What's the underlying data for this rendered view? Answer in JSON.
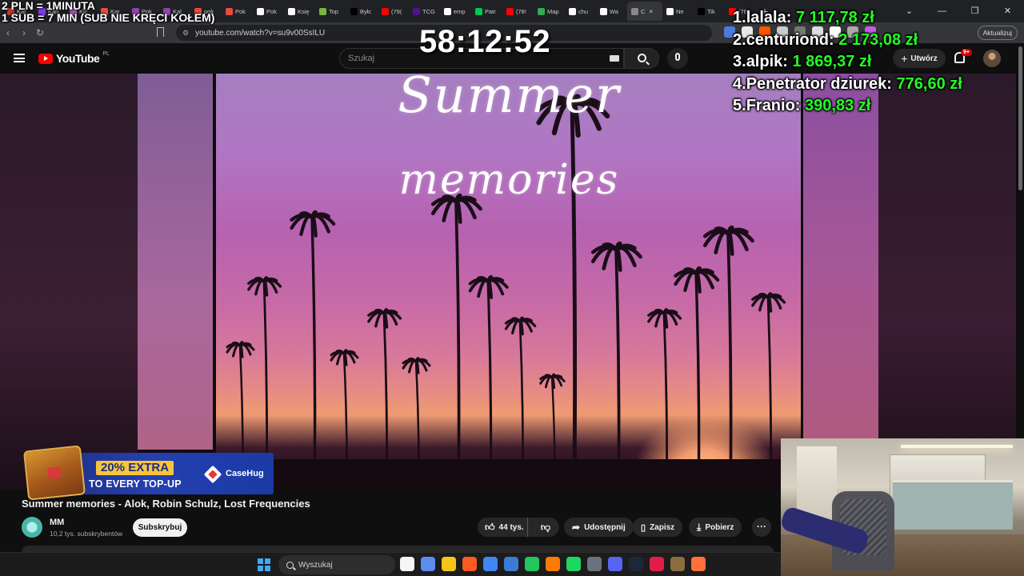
{
  "browser": {
    "tabs": [
      {
        "label": "Kar",
        "color": "#c0392b"
      },
      {
        "label": "Kan",
        "color": "#7c3aed"
      },
      {
        "label": "Kic",
        "color": "#9b59b6"
      },
      {
        "label": "Kar",
        "color": "#e74c3c"
      },
      {
        "label": "Pok",
        "color": "#8e44ad"
      },
      {
        "label": "Kal",
        "color": "#8e44ad"
      },
      {
        "label": "pok",
        "color": "#e74c3c"
      },
      {
        "label": "Pok",
        "color": "#e74c3c"
      },
      {
        "label": "Pok",
        "color": "#ffffff"
      },
      {
        "label": "Księ",
        "color": "#ffffff"
      },
      {
        "label": "Top",
        "color": "#7cb342"
      },
      {
        "label": "Byłc",
        "color": "#000000"
      },
      {
        "label": "(79(",
        "color": "#ff0000"
      },
      {
        "label": "TCG",
        "color": "#4a148c"
      },
      {
        "label": "emp",
        "color": "#ffffff"
      },
      {
        "label": "Patr",
        "color": "#00c853"
      },
      {
        "label": "(78!",
        "color": "#ff0000"
      },
      {
        "label": "Map",
        "color": "#34a853"
      },
      {
        "label": "chu",
        "color": "#ffffff"
      },
      {
        "label": "Wa",
        "color": "#ffffff"
      }
    ],
    "active_tab": {
      "label": "C",
      "close": "×"
    },
    "tabs_after": [
      {
        "label": "Ne",
        "color": "#ffffff"
      },
      {
        "label": "Tik",
        "color": "#000000"
      },
      {
        "label": "(78!",
        "color": "#ff0000"
      }
    ],
    "new_tab": "+",
    "window_controls": [
      "⌄",
      "—",
      "❐",
      "✕"
    ],
    "nav": {
      "back": "‹",
      "forward": "›",
      "reload": "↻"
    },
    "url": "youtube.com/watch?v=su9v00SsILU",
    "update_label": "Aktualizuj",
    "ext_colors": [
      "#4b7bd6",
      "#e8e8e8",
      "#ff5500",
      "#cccccc",
      "#777777",
      "#dddddd",
      "#ffffff",
      "#aaaaaa",
      "#c35de0"
    ]
  },
  "youtube": {
    "logo_text": "YouTube",
    "region": "PL",
    "search_placeholder": "Szukaj",
    "create_label": "Utwórz",
    "notif_count": "9+"
  },
  "video": {
    "overlay_title_1": "Summer",
    "overlay_title_2": "memories",
    "title": "Summer memories - Alok, Robin Schulz, Lost Frequencies",
    "channel": "MM",
    "subscribers": "10,2 tys. subskrybentów",
    "subscribe_label": "Subskrybuj",
    "likes": "44 tys.",
    "share_label": "Udostępnij",
    "save_label": "Zapisz",
    "download_label": "Pobierz",
    "more": "···"
  },
  "ad": {
    "extra": "20% EXTRA",
    "topup": "TO EVERY TOP-UP",
    "brand": "CaseHug"
  },
  "overlay": {
    "rate_line_1": "2 PLN = 1MINUTA",
    "rate_line_2": "1 SUB = 7 MIN (SUB NIE KRĘCI KOŁEM)",
    "timer": "58:12:52",
    "leaderboard": [
      {
        "rank": "1.",
        "name": "lalala:",
        "amount": "7 117,78 zł"
      },
      {
        "rank": "2.",
        "name": "centuriond:",
        "amount": "2 173,08 zł"
      },
      {
        "rank": "3.",
        "name": "alpik:",
        "amount": "1 869,37 zł"
      },
      {
        "rank": "4.",
        "name": "Penetrator dziurek:",
        "amount": "776,60 zł"
      },
      {
        "rank": "5.",
        "name": "Franio:",
        "amount": "390,83 zł"
      }
    ]
  },
  "taskbar": {
    "search_label": "Wyszukaj",
    "app_colors": [
      "#f5f5f5",
      "#5b8def",
      "#f5c518",
      "#ff5a1f",
      "#4285f4",
      "#3a7bd5",
      "#22c55e",
      "#ff7a00",
      "#1ed760",
      "#6b7280",
      "#5865f2",
      "#1b2838",
      "#e11d48",
      "#8b6d3f",
      "#ff7139"
    ]
  }
}
